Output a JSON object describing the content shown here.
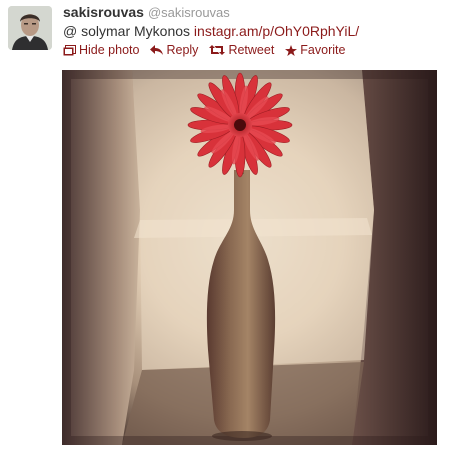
{
  "tweet": {
    "fullname": "sakisrouvas",
    "username": "@sakisrouvas",
    "text_prefix": "@ solymar Mykonos ",
    "link": "instagr.am/p/OhY0RphYiL/",
    "actions": {
      "hide_photo": "Hide photo",
      "reply": "Reply",
      "retweet": "Retweet",
      "favorite": "Favorite"
    },
    "icons": {
      "hide_photo": "photo-icon",
      "reply": "reply-arrow-icon",
      "retweet": "retweet-icon",
      "favorite": "star-icon"
    },
    "colors": {
      "link": "#8b1a1a",
      "username": "#999999",
      "text": "#333333"
    }
  }
}
